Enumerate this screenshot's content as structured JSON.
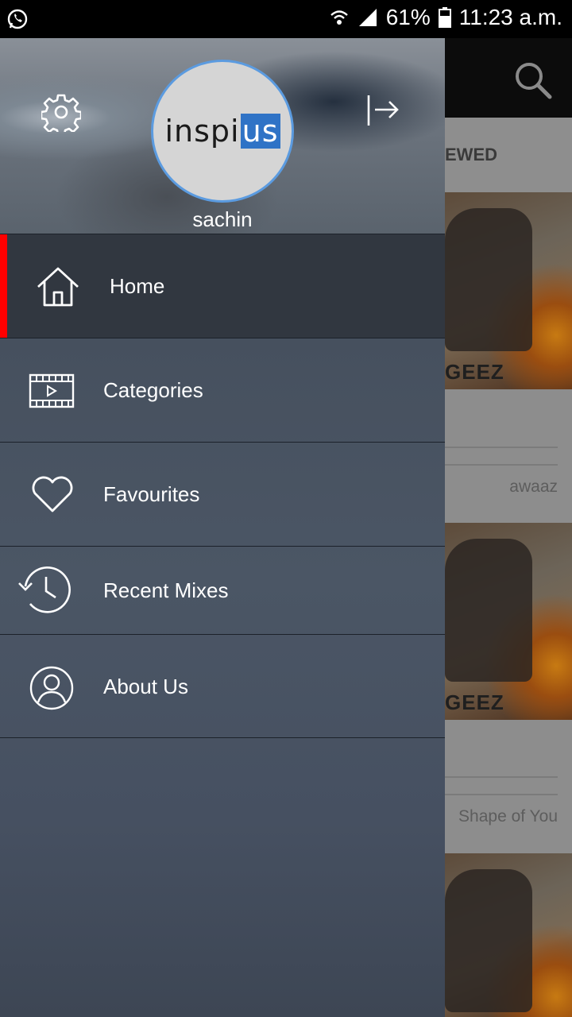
{
  "status_bar": {
    "battery": "61%",
    "time": "11:23 a.m.",
    "icons": [
      "whatsapp-icon",
      "wifi-icon",
      "signal-icon",
      "battery-icon"
    ]
  },
  "drawer": {
    "logo": {
      "text": "inspi",
      "highlight": "us"
    },
    "username": "sachin",
    "menu": [
      {
        "label": "Home",
        "icon": "home-icon",
        "active": true
      },
      {
        "label": "Categories",
        "icon": "film-icon",
        "active": false
      },
      {
        "label": "Favourites",
        "icon": "heart-icon",
        "active": false
      },
      {
        "label": "Recent Mixes",
        "icon": "history-icon",
        "active": false
      },
      {
        "label": "About Us",
        "icon": "user-icon",
        "active": false
      }
    ],
    "accent_color": "#ff0000"
  },
  "background": {
    "tab_fragment": "EWED",
    "thumb_brand": "GEEZ",
    "items": [
      {
        "meta": "awaaz"
      },
      {
        "meta": "Shape of You"
      }
    ]
  }
}
